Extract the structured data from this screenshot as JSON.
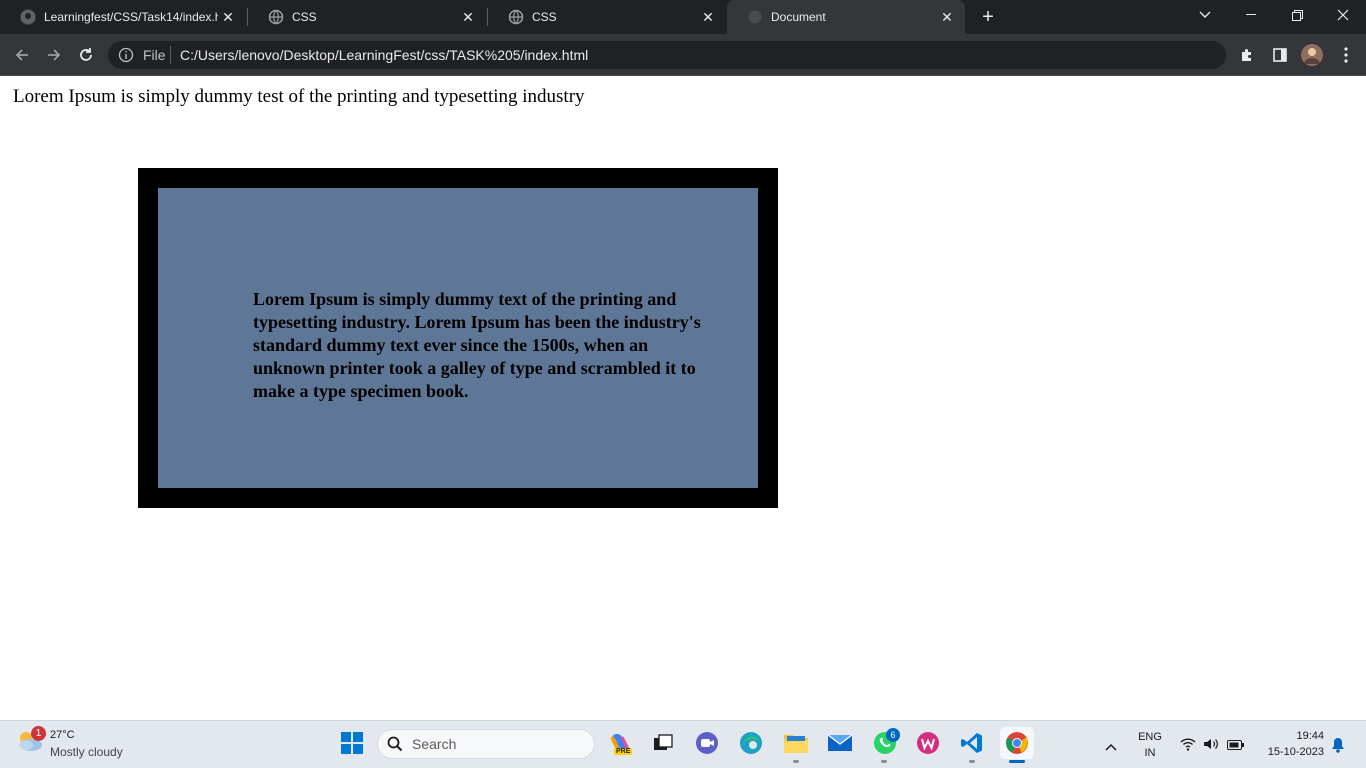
{
  "browser": {
    "tabs": [
      {
        "label": "Learningfest/CSS/Task14/index.h",
        "active": false
      },
      {
        "label": "CSS",
        "active": false
      },
      {
        "label": "CSS",
        "active": false
      },
      {
        "label": "Document",
        "active": true
      }
    ],
    "address": {
      "scheme_label": "File",
      "url": "C:/Users/lenovo/Desktop/LearningFest/css/TASK%205/index.html"
    }
  },
  "page": {
    "heading_line": "Lorem Ipsum is simply dummy test of the printing and typesetting industry",
    "box_text": "Lorem Ipsum is simply dummy text of the printing and typesetting industry. Lorem Ipsum has been the industry's standard dummy text ever since the 1500s, when an unknown printer took a galley of type and scrambled it to make a type specimen book.",
    "box_border_color": "#000000",
    "box_fill_color": "#5f7797"
  },
  "taskbar": {
    "weather": {
      "temp": "27°C",
      "desc": "Mostly cloudy",
      "badge": "1"
    },
    "search_label": "Search",
    "whatsapp_badge": "6",
    "copilot_tag": "PRE",
    "language": {
      "line1": "ENG",
      "line2": "IN"
    },
    "clock": {
      "time": "19:44",
      "date": "15-10-2023"
    }
  }
}
